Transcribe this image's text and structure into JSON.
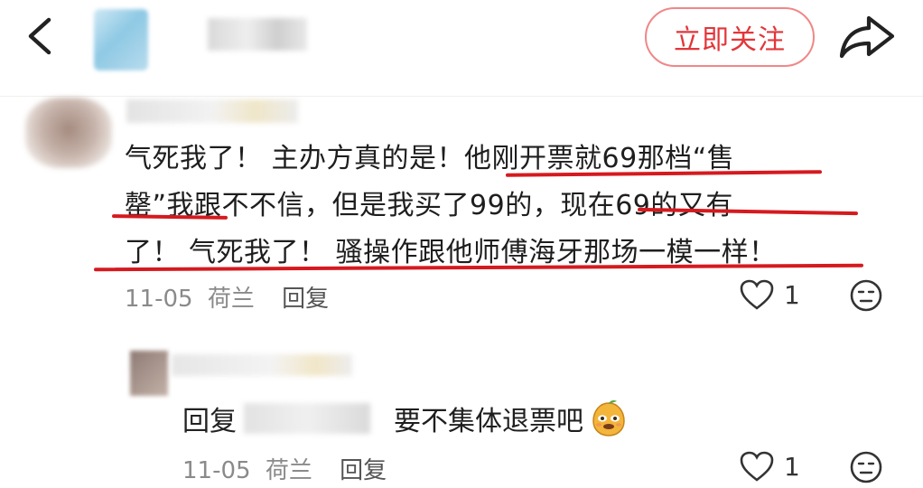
{
  "header": {
    "follow_label": "立即关注"
  },
  "comment": {
    "text_line1": "气死我了！ 主办方真的是！他刚开票就69那档“售",
    "text_line2": "罄”我跟不不信，但是我买了99的，现在69的又有",
    "text_line3": "了！ 气死我了！ 骚操作跟他师傅海牙那场一模一样！",
    "date": "11-05",
    "location": "荷兰",
    "reply_label": "回复",
    "like_count": "1"
  },
  "reply": {
    "prefix": "回复",
    "text": "要不集体退票吧",
    "emoji": "mango-face-emoji",
    "date": "11-05",
    "location": "荷兰",
    "reply_label": "回复",
    "like_count": "1"
  },
  "colors": {
    "accent": "#e2363a",
    "underline": "#d51a1f",
    "meta_gray": "#8a8a8a"
  },
  "icons": {
    "back": "chevron-left-icon",
    "share": "share-arrow-icon",
    "like": "heart-outline-icon",
    "emoji": "face-emoji-icon"
  }
}
